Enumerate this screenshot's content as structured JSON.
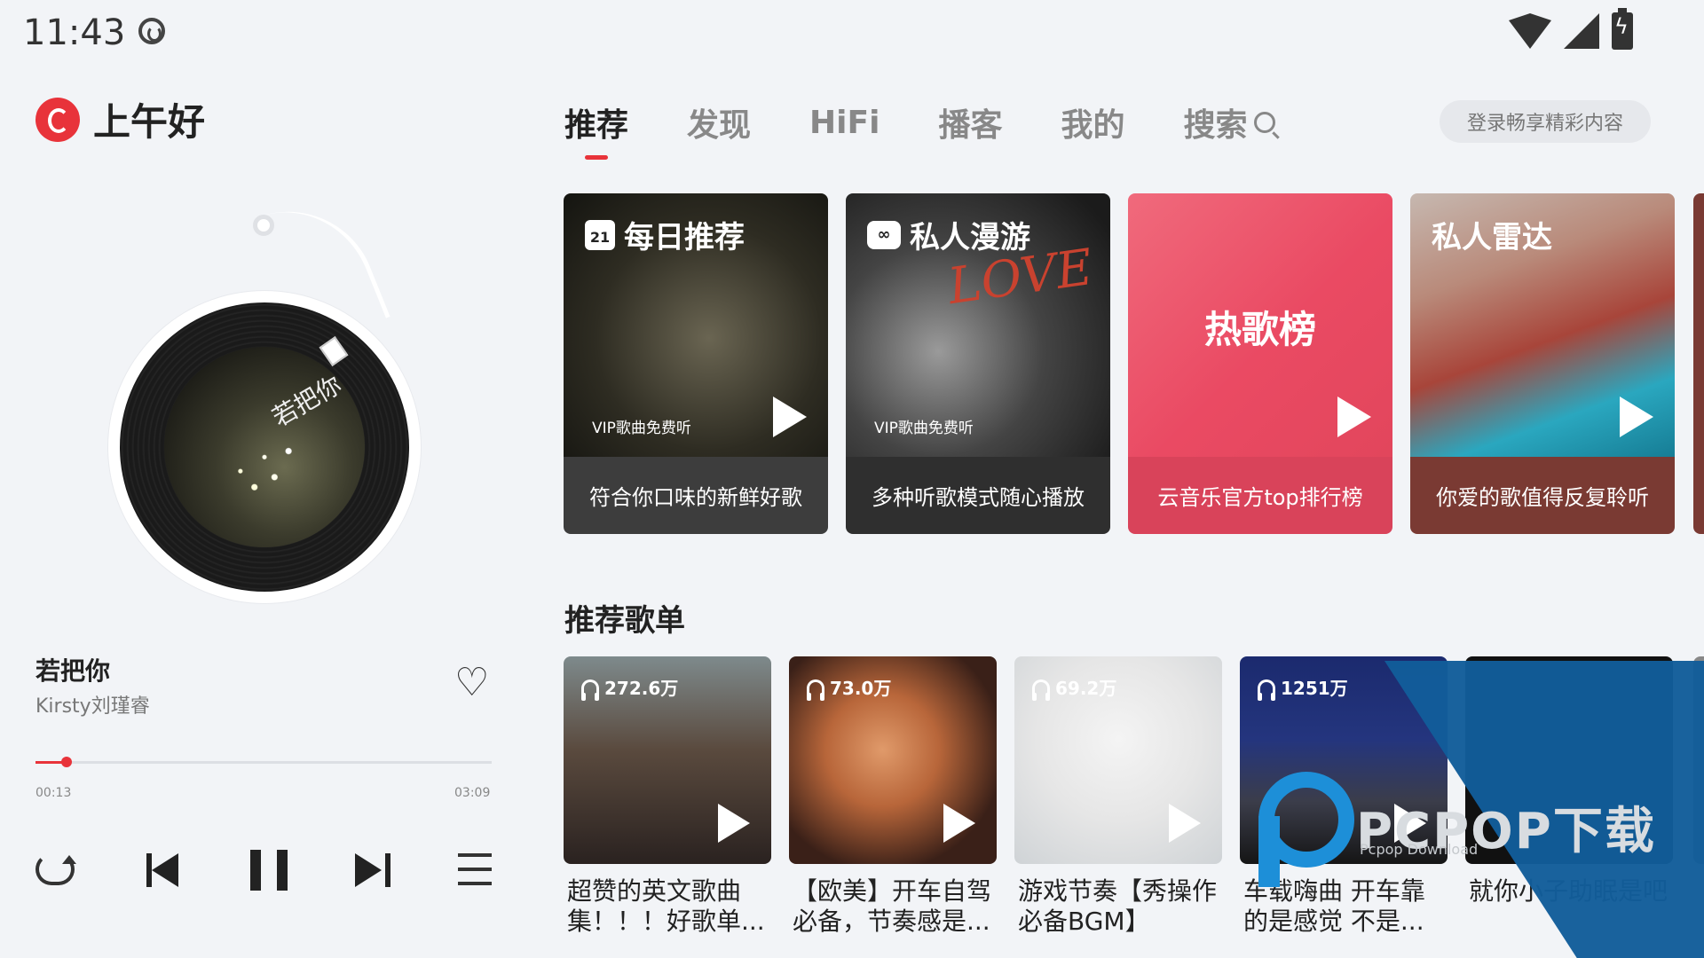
{
  "status_bar": {
    "time": "11:43"
  },
  "greeting": "上午好",
  "player": {
    "cover_text": "若把你",
    "song_title": "若把你",
    "artist": "Kirsty刘瑾睿",
    "current_time": "00:13",
    "total_time": "03:09",
    "progress": 0.069
  },
  "nav": {
    "tabs": [
      "推荐",
      "发现",
      "HiFi",
      "播客",
      "我的",
      "搜索"
    ],
    "active_tab": "推荐",
    "login_label": "登录畅享精彩内容"
  },
  "feature_cards": [
    {
      "title": "每日推荐",
      "calendar_day": "21",
      "badge": "VIP歌曲免费听",
      "subtitle": "符合你口味的新鲜好歌"
    },
    {
      "title": "私人漫游",
      "badge": "VIP歌曲免费听",
      "subtitle": "多种听歌模式随心播放",
      "art_text": "LOVE"
    },
    {
      "title": "热歌榜",
      "subtitle": "云音乐官方top排行榜"
    },
    {
      "title": "私人雷达",
      "subtitle": "你爱的歌值得反复聆听"
    }
  ],
  "section_title": "推荐歌单",
  "playlists": [
    {
      "count": "272.6万",
      "name": "超赞的英文歌曲集！！！好歌单..."
    },
    {
      "count": "73.0万",
      "name": "【欧美】开车自驾必备，节奏感是..."
    },
    {
      "count": "69.2万",
      "name": "游戏节奏【秀操作必备BGM】"
    },
    {
      "count": "1251万",
      "name": "车载嗨曲 开车靠的是感觉 不是..."
    },
    {
      "count": "",
      "name": "就你小子助眠是吧"
    }
  ],
  "watermark": {
    "text": "PCPOP下载",
    "sub": "Pcpop Download"
  },
  "colors": {
    "accent": "#e8333a",
    "background": "#f2f4f7"
  }
}
